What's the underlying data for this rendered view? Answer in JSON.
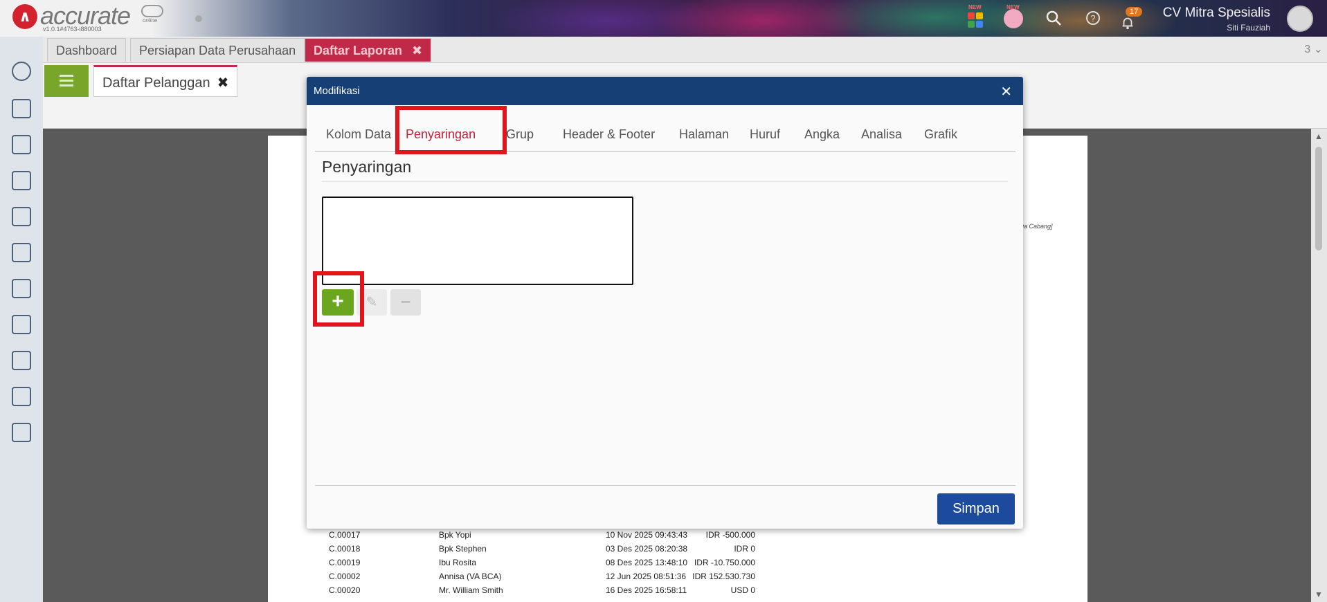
{
  "app": {
    "brand": "accurate",
    "brand_sub": "online",
    "version": "v1.0.1#4763-i880003",
    "new_label_1": "NEW",
    "new_label_2": "NEW",
    "notifications": "17",
    "company": "CV Mitra Spesialis",
    "user": "Siti Fauziah"
  },
  "tabs": {
    "dashboard": "Dashboard",
    "persiapan": "Persiapan Data Perusahaan",
    "daftar_laporan": "Daftar Laporan",
    "close": "✖",
    "count": "3 ⌄"
  },
  "subtab": {
    "label": "Daftar Pelanggan",
    "close": "✖"
  },
  "report": {
    "side_text": "ua Cabang]",
    "rows": [
      {
        "code": "C.00017",
        "name": "Bpk Yopi",
        "date": "10 Nov 2025 09:43:43",
        "amount": "IDR -500.000"
      },
      {
        "code": "C.00018",
        "name": "Bpk Stephen",
        "date": "03 Des 2025 08:20:38",
        "amount": "IDR 0"
      },
      {
        "code": "C.00019",
        "name": "Ibu Rosita",
        "date": "08 Des 2025 13:48:10",
        "amount": "IDR -10.750.000"
      },
      {
        "code": "C.00002",
        "name": "Annisa (VA BCA)",
        "date": "12 Jun 2025 08:51:36",
        "amount": "IDR 152.530.730"
      },
      {
        "code": "C.00020",
        "name": "Mr. William Smith",
        "date": "16 Des 2025 16:58:11",
        "amount": "USD 0"
      }
    ]
  },
  "modal": {
    "title": "Modifikasi",
    "close": "✕",
    "tabs": [
      "Kolom Data",
      "Penyaringan",
      "Grup",
      "Header & Footer",
      "Halaman",
      "Huruf",
      "Angka",
      "Analisa",
      "Grafik"
    ],
    "active_tab": "Penyaringan",
    "section_title": "Penyaringan",
    "add": "+",
    "edit": "✎",
    "remove": "−",
    "save": "Simpan"
  },
  "colors": {
    "accent_red": "#c22039",
    "highlight_red": "#e0161c",
    "header_blue": "#163f76",
    "save_blue": "#1c4a9d",
    "add_green": "#6aa71f"
  }
}
